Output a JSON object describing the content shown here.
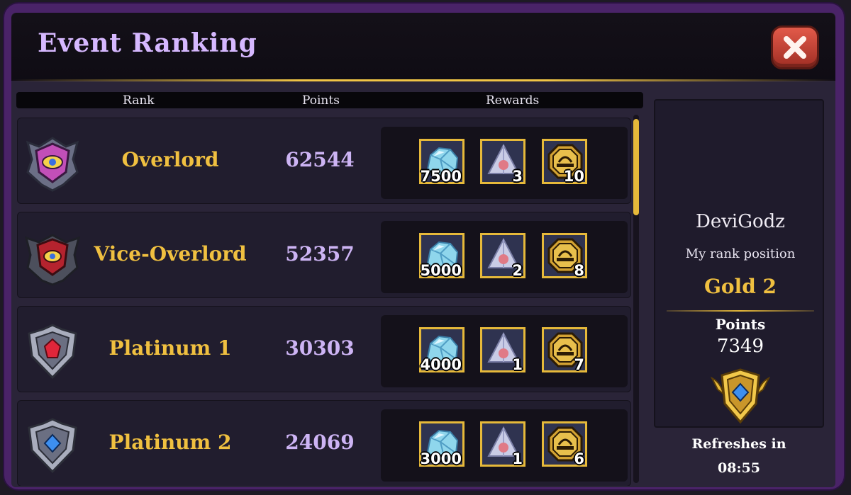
{
  "window": {
    "title": "Event Ranking"
  },
  "columns": {
    "rank": "Rank",
    "points": "Points",
    "rewards": "Rewards"
  },
  "rows": [
    {
      "rank": "Overlord",
      "points": "62544",
      "badge": "overlord-badge",
      "rewards": [
        {
          "icon": "crystal-icon",
          "qty": "7500"
        },
        {
          "icon": "pyramid-gem-icon",
          "qty": "3"
        },
        {
          "icon": "gold-coin-icon",
          "qty": "10"
        }
      ]
    },
    {
      "rank": "Vice-Overlord",
      "points": "52357",
      "badge": "vice-overlord-badge",
      "rewards": [
        {
          "icon": "crystal-icon",
          "qty": "5000"
        },
        {
          "icon": "pyramid-gem-icon",
          "qty": "2"
        },
        {
          "icon": "gold-coin-icon",
          "qty": "8"
        }
      ]
    },
    {
      "rank": "Platinum 1",
      "points": "30303",
      "badge": "platinum-ruby-badge",
      "rewards": [
        {
          "icon": "crystal-icon",
          "qty": "4000"
        },
        {
          "icon": "pyramid-gem-icon",
          "qty": "1"
        },
        {
          "icon": "gold-coin-icon",
          "qty": "7"
        }
      ]
    },
    {
      "rank": "Platinum 2",
      "points": "24069",
      "badge": "platinum-sapphire-badge",
      "rewards": [
        {
          "icon": "crystal-icon",
          "qty": "3000"
        },
        {
          "icon": "pyramid-gem-icon",
          "qty": "1"
        },
        {
          "icon": "gold-coin-icon",
          "qty": "6"
        }
      ]
    }
  ],
  "player": {
    "name": "DeviGodz",
    "rank_label": "My rank position",
    "rank": "Gold 2",
    "points_label": "Points",
    "points": "7349",
    "badge": "gold-badge"
  },
  "refresh": {
    "label": "Refreshes in",
    "time": "08:55"
  },
  "colors": {
    "accent": "#f0c040",
    "title": "#d6b8ff",
    "points": "#cdb4f4",
    "frame": "#4a2368"
  }
}
